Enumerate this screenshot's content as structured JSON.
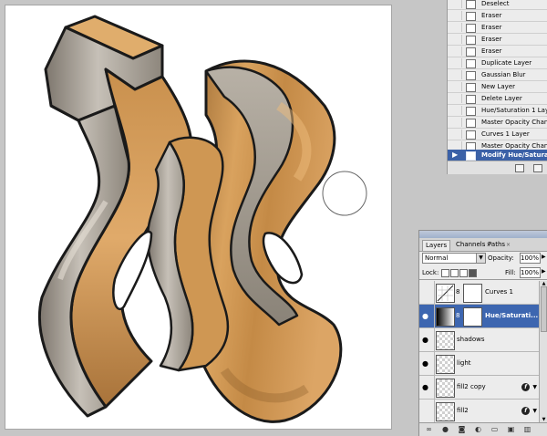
{
  "history": {
    "items": [
      {
        "label": "Deselect"
      },
      {
        "label": "Eraser"
      },
      {
        "label": "Eraser"
      },
      {
        "label": "Eraser"
      },
      {
        "label": "Eraser"
      },
      {
        "label": "Duplicate Layer"
      },
      {
        "label": "Gaussian Blur"
      },
      {
        "label": "New Layer"
      },
      {
        "label": "Delete Layer"
      },
      {
        "label": "Hue/Saturation 1 Layer"
      },
      {
        "label": "Master Opacity Change"
      },
      {
        "label": "Curves 1 Layer"
      },
      {
        "label": "Master Opacity Change"
      },
      {
        "label": "Modify Hue/Saturation"
      }
    ],
    "selected_index": 13
  },
  "layers_panel": {
    "tabs": [
      {
        "label": "Layers"
      },
      {
        "label": "Channels"
      },
      {
        "label": "Paths"
      }
    ],
    "blend_mode": "Normal",
    "opacity_label": "Opacity:",
    "opacity_value": "100%",
    "lock_label": "Lock:",
    "fill_label": "Fill:",
    "fill_value": "100%",
    "layers": [
      {
        "name": "Curves 1",
        "visible": false,
        "adjustment": true
      },
      {
        "name": "Hue/Saturati...",
        "visible": true,
        "adjustment": true,
        "selected": true
      },
      {
        "name": "shadows",
        "visible": true
      },
      {
        "name": "light",
        "visible": true
      },
      {
        "name": "fill2 copy",
        "visible": true,
        "fx": true
      },
      {
        "name": "fill2",
        "visible": false,
        "fx": true
      }
    ]
  },
  "colors": {
    "selection": "#3d66b0",
    "letter_face": "#c38c4a",
    "letter_side": "#aba398"
  }
}
